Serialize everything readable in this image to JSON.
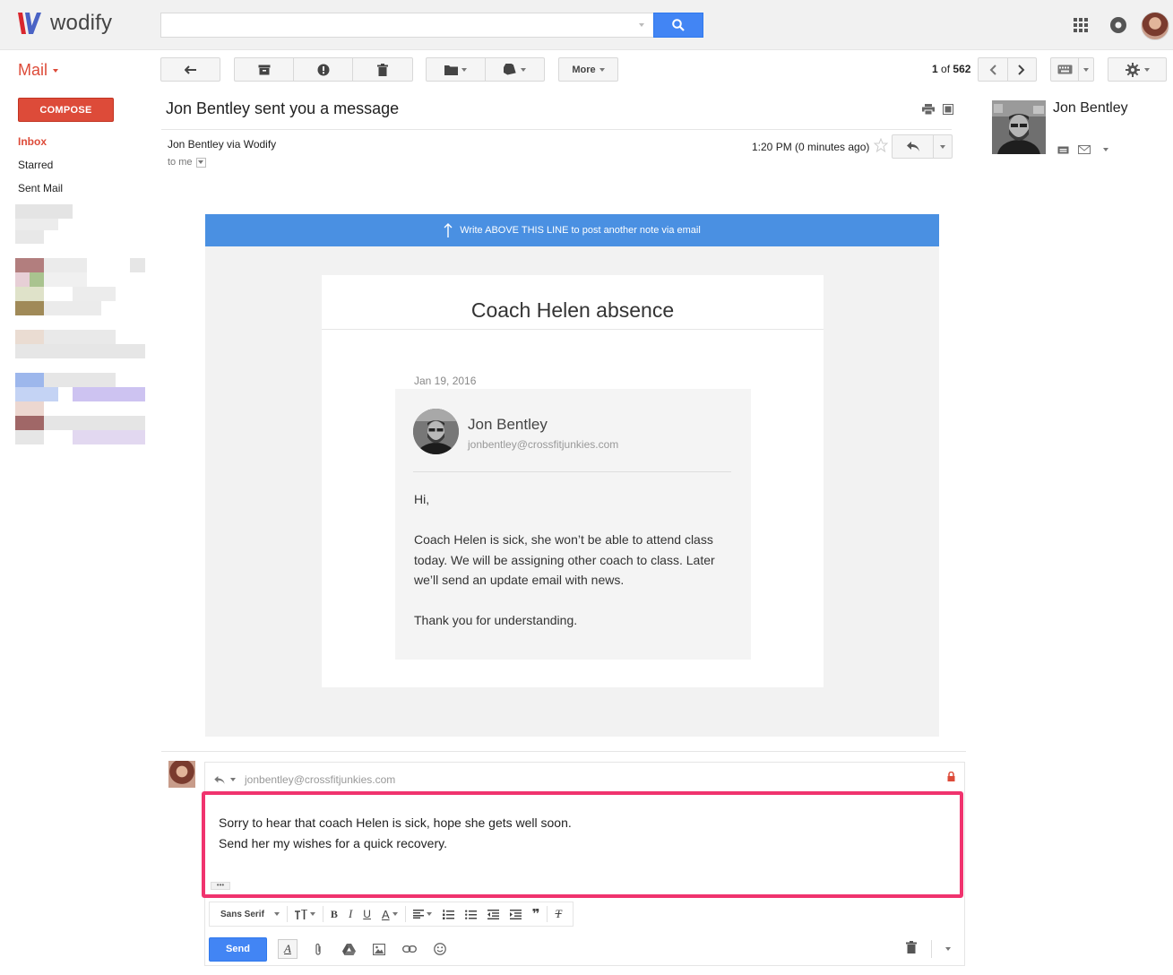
{
  "app": {
    "logo_text": "wodify",
    "brand_color": "#dd4b39",
    "accent_color": "#4285f4"
  },
  "search": {
    "value": "",
    "placeholder": ""
  },
  "toolbar": {
    "mail_label": "Mail",
    "more_label": "More",
    "pager": {
      "current": "1",
      "of_label": "of",
      "total": "562"
    }
  },
  "sidebar": {
    "compose_label": "COMPOSE",
    "items": [
      {
        "label": "Inbox",
        "active": true
      },
      {
        "label": "Starred",
        "active": false
      },
      {
        "label": "Sent Mail",
        "active": false
      }
    ]
  },
  "message": {
    "subject": "Jon Bentley sent you a message",
    "sender": "Jon Bentley via Wodify",
    "to": "to me",
    "time": "1:20 PM (0 minutes ago)"
  },
  "contact": {
    "name": "Jon Bentley"
  },
  "email": {
    "banner": "Write ABOVE THIS LINE to post another note via email",
    "title": "Coach Helen absence",
    "date": "Jan 19, 2016",
    "author_name": "Jon Bentley",
    "author_email": "jonbentley@crossfitjunkies.com",
    "greeting": "Hi,",
    "body_lines": [
      "Coach Helen is sick, she won’t be able to attend class",
      "today. We will be assigning other coach to class. Later",
      "we’ll send an update email with news."
    ],
    "signoff": "Thank you for understanding."
  },
  "reply": {
    "to": "jonbentley@crossfitjunkies.com",
    "lines": [
      "Sorry to hear that coach Helen is sick, hope she gets well soon.",
      "Send her my wishes for a quick recovery."
    ],
    "font_label": "Sans Serif",
    "send_label": "Send",
    "highlight_color": "#f0336e"
  }
}
